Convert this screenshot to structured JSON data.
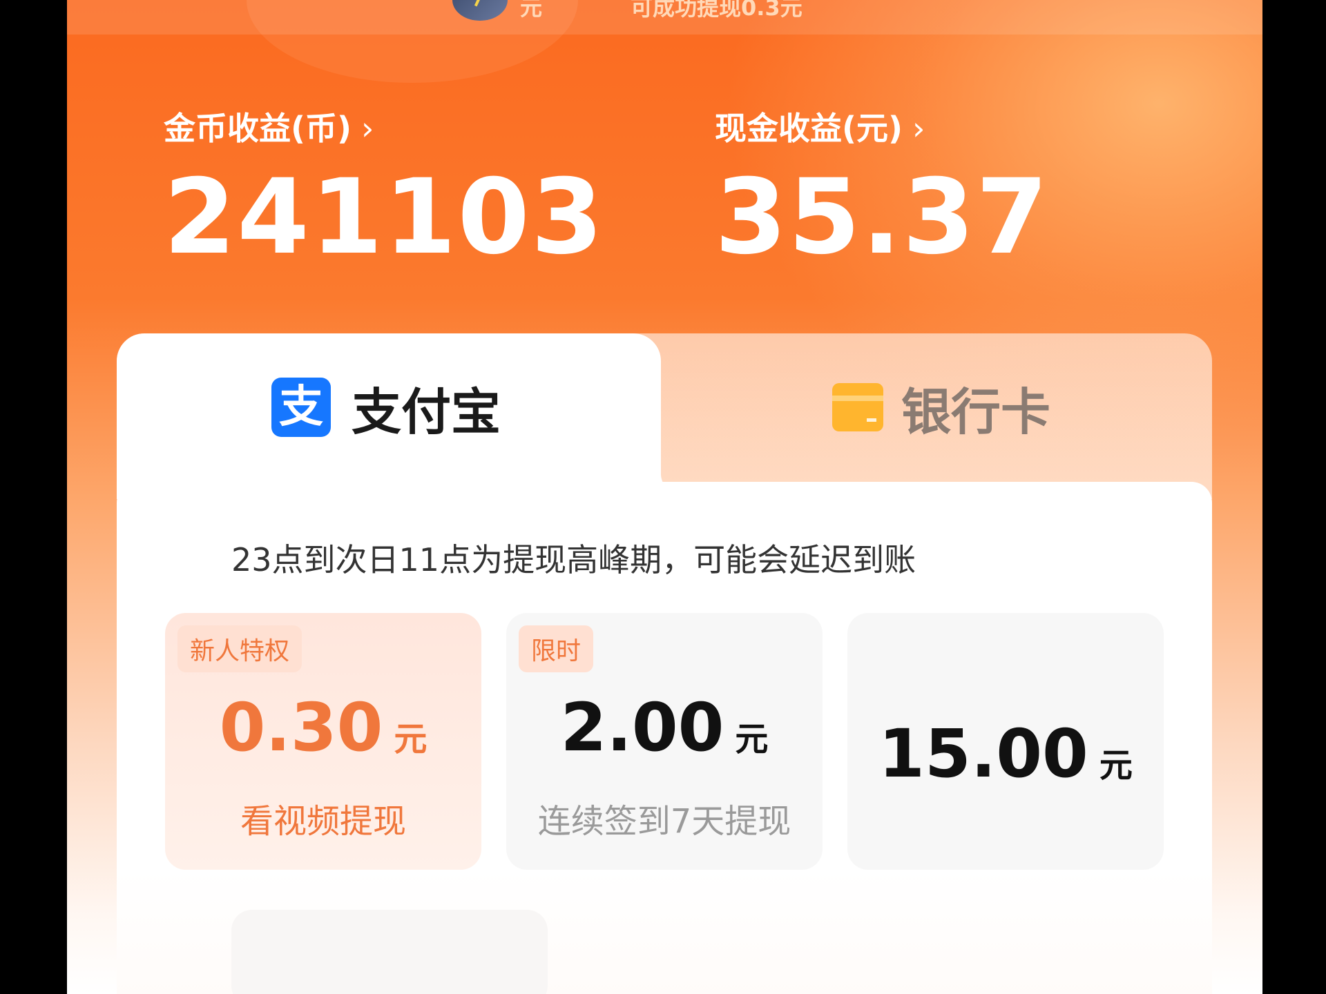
{
  "top_banner": {
    "partial_unit": "元",
    "partial_text": "可成功提现0.3元"
  },
  "earnings": {
    "coin": {
      "label": "金币收益(币)",
      "chevron": "›",
      "value": "241103"
    },
    "cash": {
      "label": "现金收益(元)",
      "chevron": "›",
      "value": "35.37"
    }
  },
  "tabs": {
    "alipay": {
      "icon_char": "支",
      "label": "支付宝"
    },
    "bank": {
      "label": "银行卡"
    }
  },
  "notice": "23点到次日11点为提现高峰期，可能会延迟到账",
  "options": [
    {
      "tag": "新人特权",
      "amount": "0.30",
      "unit": "元",
      "desc": "看视频提现",
      "selected": true
    },
    {
      "tag": "限时",
      "amount": "2.00",
      "unit": "元",
      "desc": "连续签到7天提现",
      "selected": false
    },
    {
      "tag": "",
      "amount": "15.00",
      "unit": "元",
      "desc": "",
      "selected": false
    }
  ],
  "colors": {
    "accent": "#fb6a20",
    "selected_text": "#f0773c",
    "alipay_blue": "#1677ff",
    "bank_yellow": "#ffb52e"
  },
  "icons": {
    "alipay": "alipay-icon",
    "bank": "bank-card-icon",
    "chevron": "chevron-right-icon"
  }
}
